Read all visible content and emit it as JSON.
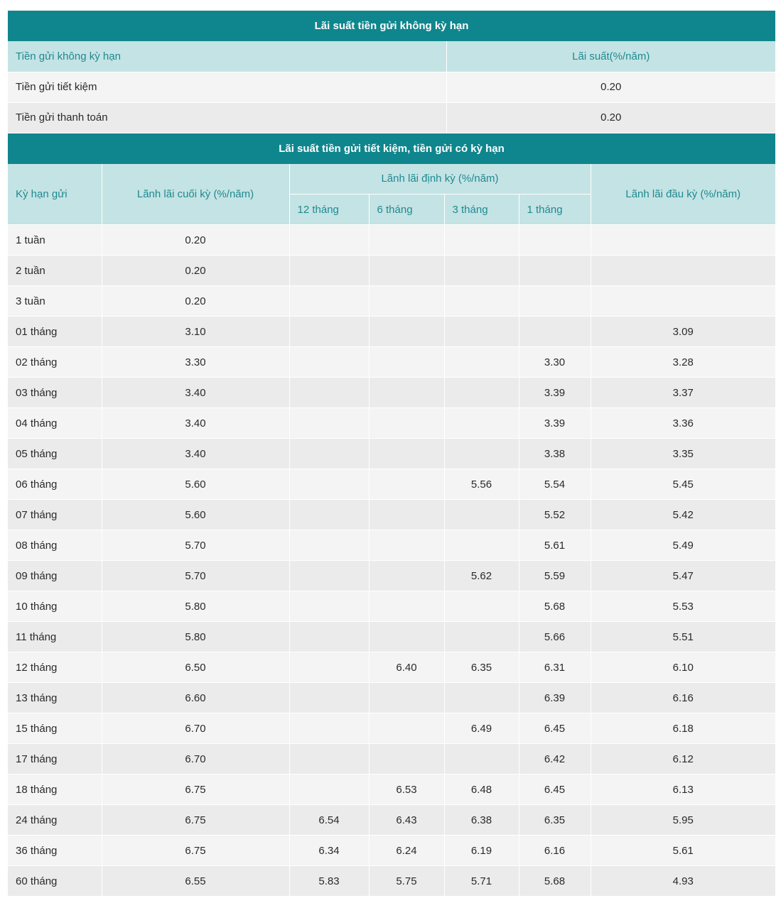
{
  "demand": {
    "title": "Lãi suất tiền gửi không kỳ hạn",
    "headers": [
      "Tiền gửi không kỳ hạn",
      "Lãi suất(%/năm)"
    ],
    "rows": [
      {
        "label": "Tiền gửi tiết kiệm",
        "rate": "0.20"
      },
      {
        "label": "Tiền gửi thanh toán",
        "rate": "0.20"
      }
    ]
  },
  "term": {
    "title": "Lãi suất tiền gửi tiết kiệm, tiền gửi có kỳ hạn",
    "headers": {
      "term": "Kỳ hạn gửi",
      "end": "Lãnh lãi cuối kỳ (%/năm)",
      "periodic": "Lãnh lãi định kỳ (%/năm)",
      "p12": "12 tháng",
      "p6": "6 tháng",
      "p3": "3 tháng",
      "p1": "1 tháng",
      "start": "Lãnh lãi đầu kỳ (%/năm)"
    },
    "rows": [
      [
        "1 tuần",
        "0.20",
        "",
        "",
        "",
        "",
        ""
      ],
      [
        "2 tuần",
        "0.20",
        "",
        "",
        "",
        "",
        ""
      ],
      [
        "3 tuần",
        "0.20",
        "",
        "",
        "",
        "",
        ""
      ],
      [
        "01 tháng",
        "3.10",
        "",
        "",
        "",
        "",
        "3.09"
      ],
      [
        "02 tháng",
        "3.30",
        "",
        "",
        "",
        "3.30",
        "3.28"
      ],
      [
        "03 tháng",
        "3.40",
        "",
        "",
        "",
        "3.39",
        "3.37"
      ],
      [
        "04 tháng",
        "3.40",
        "",
        "",
        "",
        "3.39",
        "3.36"
      ],
      [
        "05 tháng",
        "3.40",
        "",
        "",
        "",
        "3.38",
        "3.35"
      ],
      [
        "06 tháng",
        "5.60",
        "",
        "",
        "5.56",
        "5.54",
        "5.45"
      ],
      [
        "07 tháng",
        "5.60",
        "",
        "",
        "",
        "5.52",
        "5.42"
      ],
      [
        "08 tháng",
        "5.70",
        "",
        "",
        "",
        "5.61",
        "5.49"
      ],
      [
        "09 tháng",
        "5.70",
        "",
        "",
        "5.62",
        "5.59",
        "5.47"
      ],
      [
        "10 tháng",
        "5.80",
        "",
        "",
        "",
        "5.68",
        "5.53"
      ],
      [
        "11 tháng",
        "5.80",
        "",
        "",
        "",
        "5.66",
        "5.51"
      ],
      [
        "12 tháng",
        "6.50",
        "",
        "6.40",
        "6.35",
        "6.31",
        "6.10"
      ],
      [
        "13 tháng",
        "6.60",
        "",
        "",
        "",
        "6.39",
        "6.16"
      ],
      [
        "15 tháng",
        "6.70",
        "",
        "",
        "6.49",
        "6.45",
        "6.18"
      ],
      [
        "17 tháng",
        "6.70",
        "",
        "",
        "",
        "6.42",
        "6.12"
      ],
      [
        "18 tháng",
        "6.75",
        "",
        "6.53",
        "6.48",
        "6.45",
        "6.13"
      ],
      [
        "24 tháng",
        "6.75",
        "6.54",
        "6.43",
        "6.38",
        "6.35",
        "5.95"
      ],
      [
        "36 tháng",
        "6.75",
        "6.34",
        "6.24",
        "6.19",
        "6.16",
        "5.61"
      ],
      [
        "60 tháng",
        "6.55",
        "5.83",
        "5.75",
        "5.71",
        "5.68",
        "4.93"
      ]
    ]
  }
}
